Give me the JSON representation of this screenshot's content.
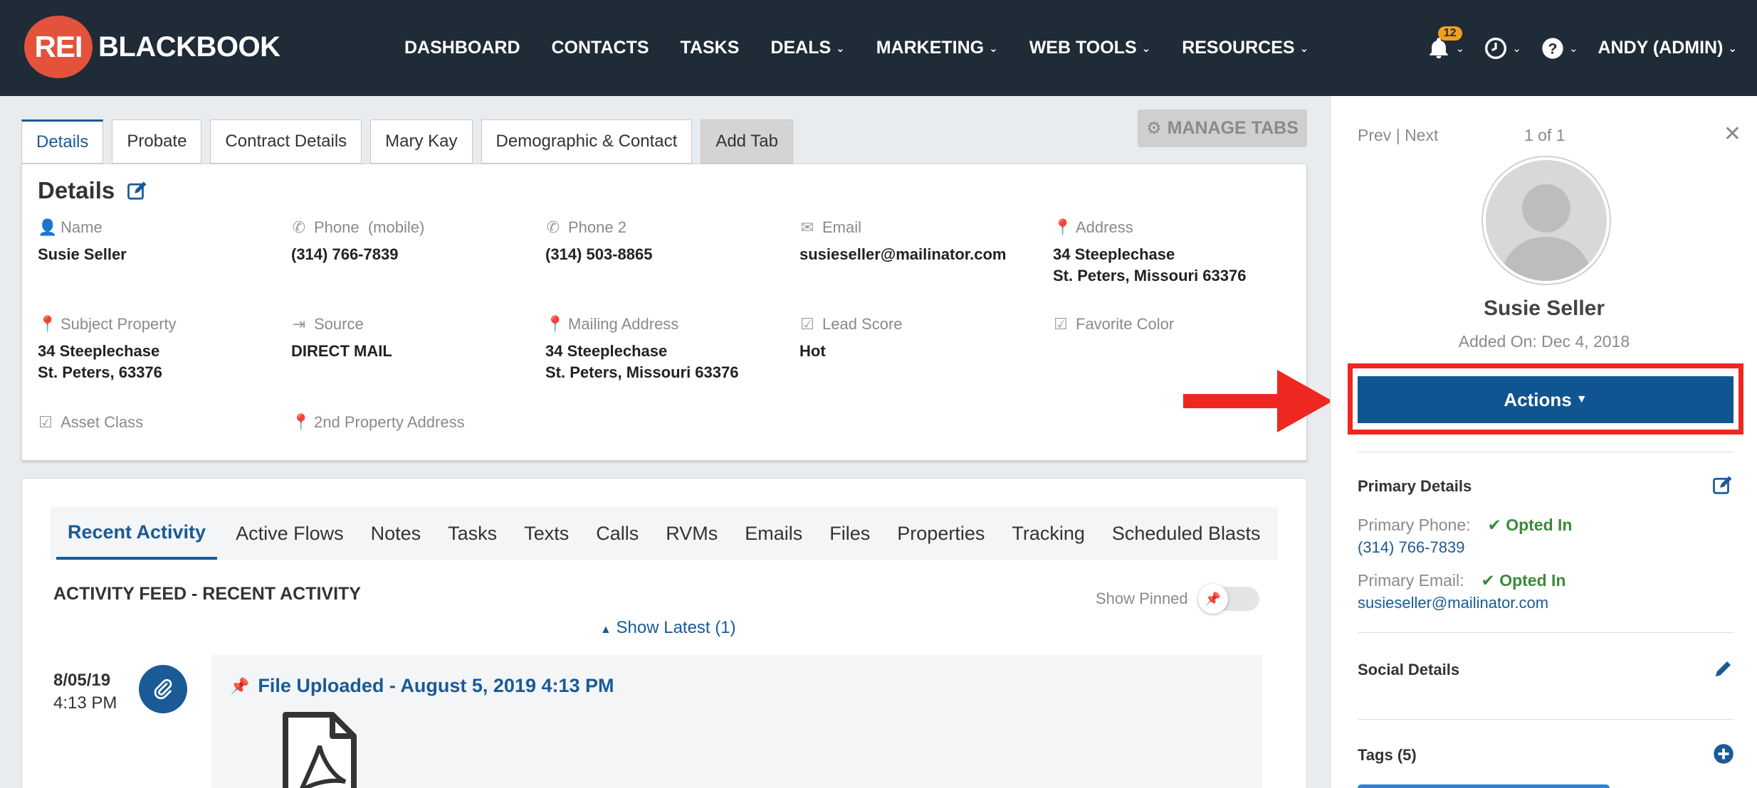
{
  "brand": {
    "logo_mark": "REI",
    "logo_text": "BLACKBOOK"
  },
  "nav": {
    "items": [
      {
        "label": "DASHBOARD",
        "dropdown": false
      },
      {
        "label": "CONTACTS",
        "dropdown": false
      },
      {
        "label": "TASKS",
        "dropdown": false
      },
      {
        "label": "DEALS",
        "dropdown": true
      },
      {
        "label": "MARKETING",
        "dropdown": true
      },
      {
        "label": "WEB TOOLS",
        "dropdown": true
      },
      {
        "label": "RESOURCES",
        "dropdown": true
      }
    ],
    "notifications_count": "12",
    "user": "ANDY (ADMIN)"
  },
  "tabs": {
    "items": [
      "Details",
      "Probate",
      "Contract Details",
      "Mary Kay",
      "Demographic & Contact",
      "Add Tab"
    ],
    "active": "Details",
    "manage_label": "MANAGE TABS"
  },
  "details": {
    "title": "Details",
    "fields": {
      "name": {
        "label": "Name",
        "value": "Susie Seller"
      },
      "phone": {
        "label": "Phone  (mobile)",
        "value": "(314) 766-7839"
      },
      "phone2": {
        "label": "Phone 2",
        "value": "(314) 503-8865"
      },
      "email": {
        "label": "Email",
        "value": "susieseller@mailinator.com"
      },
      "address": {
        "label": "Address",
        "line1": "34 Steeplechase",
        "line2": "St. Peters, Missouri 63376"
      },
      "subject_property": {
        "label": "Subject Property",
        "line1": "34 Steeplechase",
        "line2": "St. Peters, 63376"
      },
      "source": {
        "label": "Source",
        "value": "DIRECT MAIL"
      },
      "mailing_address": {
        "label": "Mailing Address",
        "line1": "34 Steeplechase",
        "line2": "St. Peters, Missouri 63376"
      },
      "lead_score": {
        "label": "Lead Score",
        "value": "Hot"
      },
      "favorite_color": {
        "label": "Favorite Color",
        "value": ""
      },
      "asset_class": {
        "label": "Asset Class",
        "value": ""
      },
      "second_property": {
        "label": "2nd Property Address",
        "value": ""
      }
    }
  },
  "activity": {
    "tabs": [
      "Recent Activity",
      "Active Flows",
      "Notes",
      "Tasks",
      "Texts",
      "Calls",
      "RVMs",
      "Emails",
      "Files",
      "Properties",
      "Tracking",
      "Scheduled Blasts"
    ],
    "active": "Recent Activity",
    "feed_title": "ACTIVITY FEED - RECENT ACTIVITY",
    "show_pinned": "Show Pinned",
    "show_latest": "Show Latest (1)",
    "item": {
      "date": "8/05/19",
      "time": "4:13 PM",
      "title": "File Uploaded - August 5, 2019 4:13 PM"
    }
  },
  "sidebar": {
    "prev": "Prev",
    "next": "Next",
    "divider": "|",
    "counter": "1 of 1",
    "contact_name": "Susie Seller",
    "added_on": "Added On: Dec 4, 2018",
    "actions_label": "Actions",
    "primary_details": {
      "title": "Primary Details",
      "phone_label": "Primary Phone:",
      "phone_status": "Opted In",
      "phone_value": "(314) 766-7839",
      "email_label": "Primary Email:",
      "email_status": "Opted In",
      "email_value": "susieseller@mailinator.com"
    },
    "social_title": "Social Details",
    "tags_title": "Tags (5)"
  },
  "colors": {
    "nav_bg": "#1f2b37",
    "brand_red": "#e4523b",
    "accent_blue": "#1a5a96",
    "actions_blue": "#0f5591",
    "highlight_red": "#ee2820",
    "opted_green": "#3a8a3a"
  }
}
